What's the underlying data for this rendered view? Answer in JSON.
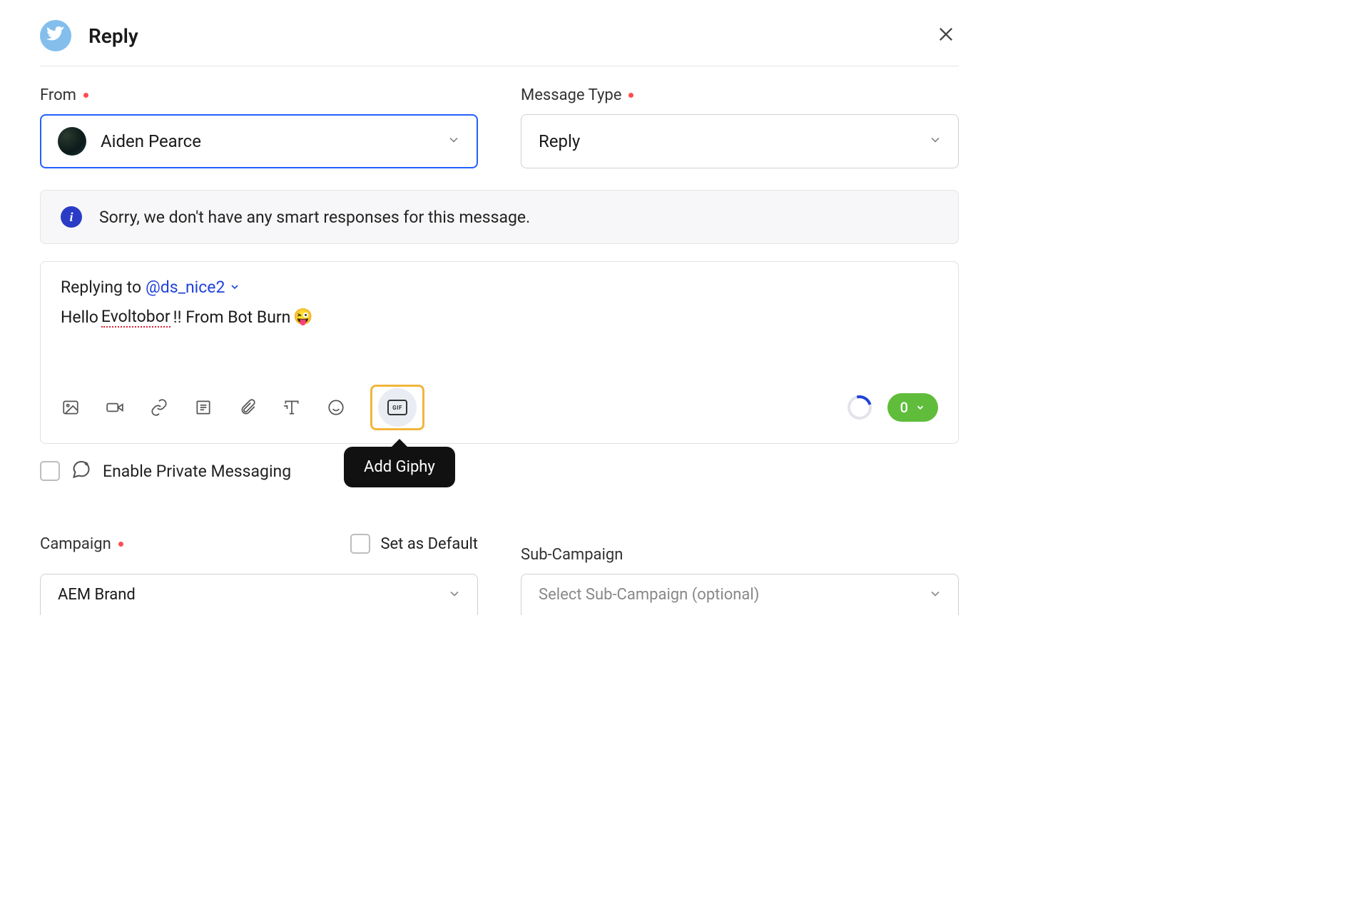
{
  "header": {
    "title": "Reply"
  },
  "from": {
    "label": "From",
    "value": "Aiden Pearce"
  },
  "messageType": {
    "label": "Message Type",
    "value": "Reply"
  },
  "alert": {
    "text": "Sorry, we don't have any smart responses for this message."
  },
  "editor": {
    "replyingPrefix": "Replying to ",
    "handle": "@ds_nice2",
    "messagePart1": "Hello ",
    "messageSpell": "Evoltobor",
    "messagePart2": "!! From Bot Burn ",
    "emoji": "😜"
  },
  "toolbar": {
    "gifLabel": "GIF",
    "pillValue": "0",
    "tooltip": "Add Giphy"
  },
  "privateMessaging": {
    "label": "Enable Private Messaging"
  },
  "campaign": {
    "label": "Campaign",
    "value": "AEM Brand",
    "setDefaultLabel": "Set as Default"
  },
  "subCampaign": {
    "label": "Sub-Campaign",
    "placeholder": "Select Sub-Campaign (optional)"
  }
}
